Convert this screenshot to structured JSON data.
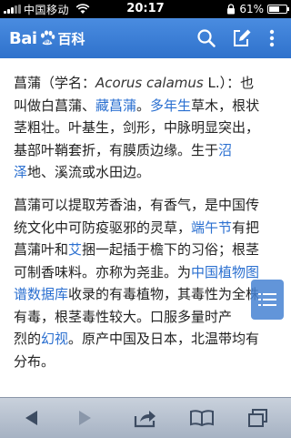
{
  "status_bar": {
    "carrier": "中国移动",
    "time": "20:17",
    "battery_percent": "61%",
    "battery_level": 0.61
  },
  "header": {
    "logo_left": "Bai",
    "logo_right": "百科",
    "icons": [
      "search-icon",
      "edit-icon",
      "more-icon"
    ]
  },
  "article": {
    "p1": {
      "l1_a": "菖蒲（学名：",
      "l1_latin": "Acorus calamus",
      "l1_b": " L.）：也",
      "l2": "叫做白菖蒲、",
      "l2_link1": "藏菖蒲",
      "l2_sep": "。",
      "l2_link2": "多年生",
      "l2_b": "草木，根状",
      "l3": "茎粗壮。叶基生，剑形，中脉明显突出，",
      "l4": "基部叶鞘套折，有膜质边缘。生于",
      "l4_link": "沼",
      "l5_link": "泽",
      "l5": "地、溪流或水田边。"
    },
    "p2": {
      "l1": "菖蒲可以提取芳香油，有香气，是中国传",
      "l2": "统文化中可防疫驱邪的灵草，",
      "l2_link": "端午节",
      "l2_b": "有把",
      "l3_a": "菖蒲叶和",
      "l3_link": "艾",
      "l3_b": "捆一起插于檐下的习俗；根茎",
      "l4": "可制香味料。亦称为尧韭。为",
      "l4_link": "中国植物图",
      "l5_link": "谱数据库",
      "l5": "收录的有毒植物，其毒性为全株",
      "l6": "有毒，根茎毒性较大。口服多量时产",
      "l7_a": "烈的",
      "l7_link": "幻视",
      "l7_b": "。原产中国及日本，北温带均有",
      "l8": "分布。"
    }
  },
  "toolbar": {
    "icons": [
      "back-icon",
      "forward-icon",
      "share-icon",
      "bookmarks-icon",
      "tabs-icon"
    ]
  },
  "colors": {
    "header_blue": "#3c7fd6",
    "link_blue": "#2a6fd0",
    "text": "#222222"
  }
}
